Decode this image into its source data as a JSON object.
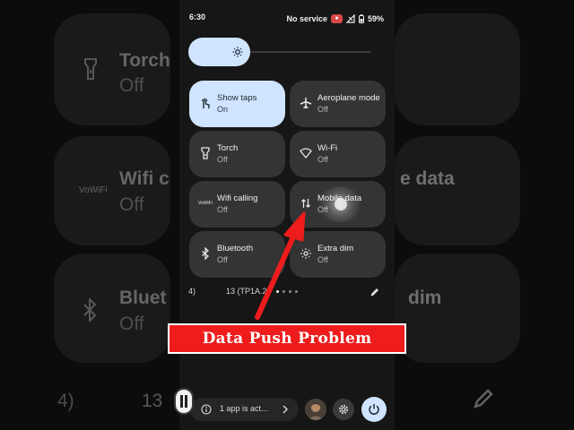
{
  "background": {
    "tiles": [
      {
        "title": "Torch",
        "state": "Off"
      },
      {
        "title": "Wifi c",
        "state": "Off",
        "icon_text": "VoWiFi"
      },
      {
        "title": "Bluet",
        "state": "Off"
      }
    ],
    "right_tiles": [
      {
        "title": "e data"
      },
      {
        "title": "dim"
      }
    ],
    "bottom_left": "4)",
    "bottom_mid": "13"
  },
  "status_bar": {
    "time": "6:30",
    "network": "No service",
    "battery": "59%"
  },
  "brightness": {
    "level": 0.33
  },
  "tiles": [
    {
      "label": "Show taps",
      "state": "On",
      "icon": "touch-icon",
      "active": true
    },
    {
      "label": "Aeroplane mode",
      "state": "Off",
      "icon": "airplane-icon",
      "active": false
    },
    {
      "label": "Torch",
      "state": "Off",
      "icon": "torch-icon",
      "active": false
    },
    {
      "label": "Wi-Fi",
      "state": "Off",
      "icon": "wifi-icon",
      "active": false
    },
    {
      "label": "Wifi calling",
      "state": "Off",
      "icon": "wifi-calling-icon",
      "icon_text": "VoWiFi",
      "active": false
    },
    {
      "label": "Mobile data",
      "state": "Off",
      "icon": "mobile-data-icon",
      "active": false
    },
    {
      "label": "Bluetooth",
      "state": "Off",
      "icon": "bluetooth-icon",
      "active": false
    },
    {
      "label": "Extra dim",
      "state": "Off",
      "icon": "extra-dim-icon",
      "active": false
    }
  ],
  "build": {
    "lead": "4)",
    "text": "13 (TP1A.2"
  },
  "notification": {
    "text": "1 app is act..."
  },
  "annotation": {
    "text": "Data Push Problem"
  },
  "colors": {
    "active_tile": "#cfe4ff",
    "inactive_tile": "#343434",
    "banner": "#ee1c1c",
    "arrow": "#ee1c1c"
  }
}
